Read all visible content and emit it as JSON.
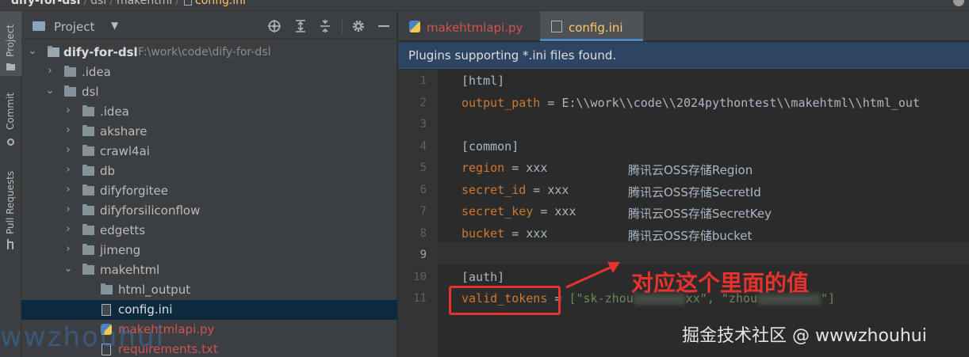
{
  "breadcrumb": {
    "items": [
      "dify-for-dsl",
      "dsl",
      "makehtml",
      "config.ini"
    ]
  },
  "stripe": {
    "tabs": [
      "Project",
      "Commit",
      "Pull Requests"
    ]
  },
  "project_panel": {
    "title": "Project",
    "dropdown_glyph": "▼",
    "tree": [
      {
        "label": "dify-for-dsl",
        "path": "F:\\work\\code\\dify-for-dsl",
        "depth": 0,
        "expanded": true,
        "kind": "root"
      },
      {
        "label": ".idea",
        "depth": 1,
        "expanded": false,
        "kind": "folder"
      },
      {
        "label": "dsl",
        "depth": 1,
        "expanded": true,
        "kind": "folder"
      },
      {
        "label": ".idea",
        "depth": 2,
        "expanded": false,
        "kind": "folder"
      },
      {
        "label": "akshare",
        "depth": 2,
        "expanded": false,
        "kind": "folder"
      },
      {
        "label": "crawl4ai",
        "depth": 2,
        "expanded": false,
        "kind": "folder"
      },
      {
        "label": "db",
        "depth": 2,
        "expanded": false,
        "kind": "folder"
      },
      {
        "label": "difyforgitee",
        "depth": 2,
        "expanded": false,
        "kind": "folder"
      },
      {
        "label": "difyforsiliconflow",
        "depth": 2,
        "expanded": false,
        "kind": "folder"
      },
      {
        "label": "edgetts",
        "depth": 2,
        "expanded": false,
        "kind": "folder"
      },
      {
        "label": "jimeng",
        "depth": 2,
        "expanded": false,
        "kind": "folder"
      },
      {
        "label": "makehtml",
        "depth": 2,
        "expanded": true,
        "kind": "folder"
      },
      {
        "label": "html_output",
        "depth": 3,
        "kind": "folder-leaf"
      },
      {
        "label": "config.ini",
        "depth": 3,
        "kind": "ini",
        "selected": true
      },
      {
        "label": "makehtmlapi.py",
        "depth": 3,
        "kind": "py",
        "modified": true
      },
      {
        "label": "requirements.txt",
        "depth": 3,
        "kind": "txt",
        "modified": true
      }
    ]
  },
  "editor": {
    "tabs": [
      {
        "label": "makehtmlapi.py",
        "active": false
      },
      {
        "label": "config.ini",
        "active": true
      }
    ],
    "banner": "Plugins supporting *.ini files found.",
    "current_line": 9,
    "lines": [
      {
        "n": "1",
        "sec": "[html]"
      },
      {
        "n": "2",
        "key": "output_path",
        "eq": " = ",
        "val": "E:\\\\work\\\\code\\\\2024pythontest\\\\makehtml\\\\html_out"
      },
      {
        "n": "3"
      },
      {
        "n": "4",
        "sec": "[common]"
      },
      {
        "n": "5",
        "key": "region",
        "eq": " = ",
        "val": "xxx",
        "comment": "腾讯云OSS存储Region"
      },
      {
        "n": "6",
        "key": "secret_id",
        "eq": " = ",
        "val": "xxx",
        "comment": "腾讯云OSS存储SecretId"
      },
      {
        "n": "7",
        "key": "secret_key",
        "eq": " = ",
        "val": "xxx",
        "comment": "腾讯云OSS存储SecretKey"
      },
      {
        "n": "8",
        "key": "bucket",
        "eq": " = ",
        "val": "xxx",
        "comment": "腾讯云OSS存储bucket"
      },
      {
        "n": "9"
      },
      {
        "n": "10",
        "sec": "[auth]"
      },
      {
        "n": "11",
        "key": "valid_tokens",
        "eq": " = ",
        "open": "[\"sk-zhou",
        "mid": "xx\", \"zhou",
        "close": "\"]"
      }
    ]
  },
  "annotation": {
    "text": "对应这个里面的值",
    "color": "#e8322d"
  },
  "watermarks": {
    "left": "wwzhouhui",
    "right": "掘金技术社区 @ wwwzhouhui"
  },
  "colors": {
    "accent": "#4a88c7",
    "selection": "#0d293e",
    "banner": "#2d4563",
    "key": "#cc7832",
    "string": "#6a8759",
    "modified_file": "#d25252"
  }
}
